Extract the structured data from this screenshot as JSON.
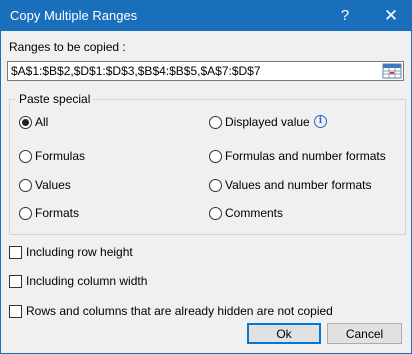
{
  "window": {
    "title": "Copy Multiple Ranges",
    "help_glyph": "?",
    "close_glyph": "✕"
  },
  "ranges": {
    "label": "Ranges to be copied :",
    "value": "$A$1:$B$2,$D$1:$D$3,$B$4:$B$5,$A$7:$D$7",
    "picker_icon": "range-select-icon"
  },
  "paste_special": {
    "title": "Paste special",
    "options": [
      {
        "label": "All",
        "selected": true
      },
      {
        "label": "Displayed value",
        "selected": false
      },
      {
        "label": "Formulas",
        "selected": false
      },
      {
        "label": "Formulas and number formats",
        "selected": false
      },
      {
        "label": "Values",
        "selected": false
      },
      {
        "label": "Values and number formats",
        "selected": false
      },
      {
        "label": "Formats",
        "selected": false
      },
      {
        "label": "Comments",
        "selected": false
      }
    ],
    "info_glyph": "i"
  },
  "options": [
    {
      "label": "Including row height",
      "checked": false
    },
    {
      "label": "Including column width",
      "checked": false
    },
    {
      "label": "Rows and columns that are already hidden are not copied",
      "checked": false
    }
  ],
  "buttons": {
    "ok": "Ok",
    "cancel": "Cancel"
  }
}
